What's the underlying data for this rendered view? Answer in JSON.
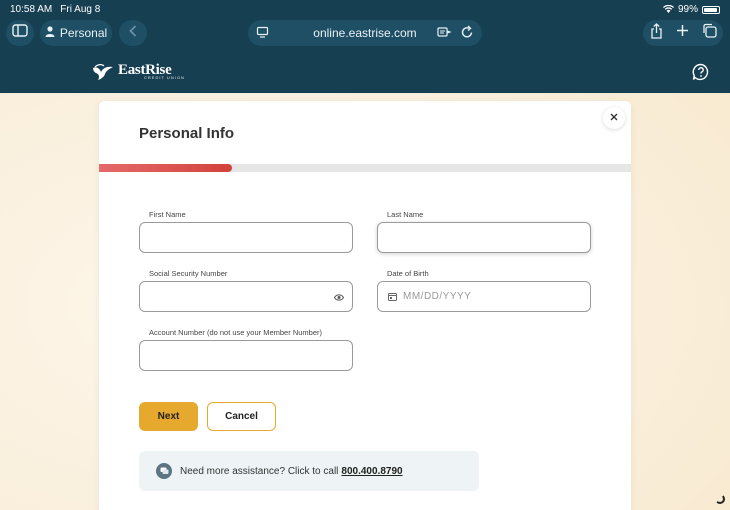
{
  "status": {
    "time": "10:58 AM",
    "date": "Fri Aug 8",
    "battery": "99%"
  },
  "browser": {
    "profile_label": "Personal",
    "url": "online.eastrise.com"
  },
  "brand": {
    "name": "EastRise",
    "tagline": "CREDIT UNION"
  },
  "form": {
    "title": "Personal Info",
    "progress": 0.25,
    "first_name": {
      "label": "First Name",
      "value": "",
      "placeholder": ""
    },
    "last_name": {
      "label": "Last Name",
      "value": "",
      "placeholder": ""
    },
    "ssn": {
      "label": "Social Security Number",
      "value": "",
      "placeholder": ""
    },
    "dob": {
      "label": "Date of Birth",
      "value": "",
      "placeholder": "MM/DD/YYYY"
    },
    "account_number": {
      "label": "Account Number (do not use your Member Number)",
      "value": "",
      "placeholder": ""
    },
    "next_label": "Next",
    "cancel_label": "Cancel"
  },
  "assist": {
    "text": "Need more assistance? Click to call",
    "phone": "800.400.8790"
  },
  "colors": {
    "header": "#163f52",
    "accent": "#e7a82e",
    "progress": "#d2423b"
  },
  "icons": [
    "sidebar-icon",
    "person-icon",
    "back-chevron-icon",
    "site-settings-icon",
    "reader-icon",
    "reload-icon",
    "share-icon",
    "plus-icon",
    "tabs-icon",
    "help-icon",
    "close-icon",
    "eye-icon",
    "calendar-icon",
    "chat-icon"
  ]
}
